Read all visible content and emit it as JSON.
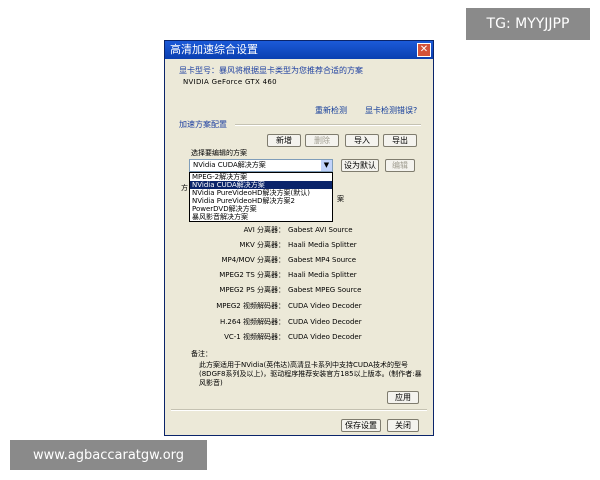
{
  "overlays": {
    "tag": "TG: MYYJJPP",
    "url": "www.agbaccaratgw.org"
  },
  "window": {
    "title": "高清加速综合设置",
    "close": "✕"
  },
  "gpu": {
    "section_label": "显卡型号：暴风将根据显卡类型为您推荐合适的方案",
    "model": "NVIDIA GeForce GTX 460",
    "redetect": "重新检测",
    "report_error": "显卡检测错误?"
  },
  "scheme": {
    "section_label": "加速方案配置",
    "buttons": {
      "add": "新增",
      "delete": "删除",
      "import": "导入",
      "export": "导出"
    },
    "select_label": "选择要编辑的方案",
    "selected": "NVidia CUDA解决方案",
    "set_default": "设为默认",
    "edit": "编辑",
    "options": [
      "MPEG-2解决方案",
      "NVidia CUDA解决方案",
      "NVidia PureVideoHD解决方案(默认)",
      "NVidia PureVideoHD解决方案2",
      "PowerDVD解决方案",
      "暴风影音解决方案"
    ],
    "selected_index": 1
  },
  "detail": {
    "partial_label": "方",
    "partial_right": "案",
    "rows": [
      {
        "label": "AVI 分离器：",
        "value": "Gabest AVI Source"
      },
      {
        "label": "MKV 分离器：",
        "value": "Haali Media Splitter"
      },
      {
        "label": "MP4/MOV 分离器：",
        "value": "Gabest MP4 Source"
      },
      {
        "label": "MPEG2 TS 分离器：",
        "value": "Haali Media Splitter"
      },
      {
        "label": "MPEG2 PS 分离器：",
        "value": "Gabest MPEG Source"
      },
      {
        "label": "MPEG2 视频解码器：",
        "value": "CUDA Video Decoder"
      },
      {
        "label": "H.264 视频解码器：",
        "value": "CUDA Video Decoder"
      },
      {
        "label": "VC-1 视频解码器：",
        "value": "CUDA Video Decoder"
      }
    ],
    "notes_label": "备注：",
    "notes": "此方案适用于NVidia(英伟达)高清显卡系列中支持CUDA技术的型号(8DGF8系列及以上)，驱动程序推荐安装官方185以上版本。(制作者:暴风影音)"
  },
  "footer": {
    "apply": "应用",
    "save": "保存设置",
    "close": "关闭"
  }
}
